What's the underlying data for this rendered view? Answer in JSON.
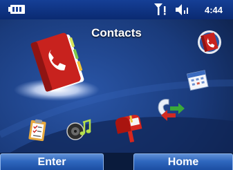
{
  "status": {
    "time": "4:44",
    "battery_icon": "battery-icon",
    "signal_icon": "signal-icon",
    "volume_icon": "volume-icon"
  },
  "home": {
    "selected_title": "Contacts",
    "apps": [
      {
        "id": "contacts",
        "icon": "contacts-book-icon",
        "selected": true
      },
      {
        "id": "contacts-small",
        "icon": "contacts-small-icon"
      },
      {
        "id": "calendar",
        "icon": "calendar-icon"
      },
      {
        "id": "call-history",
        "icon": "call-history-icon"
      },
      {
        "id": "tasks",
        "icon": "clipboard-icon"
      },
      {
        "id": "music",
        "icon": "music-icon"
      },
      {
        "id": "messaging",
        "icon": "mailbox-icon"
      }
    ]
  },
  "softkeys": {
    "left": "Enter",
    "right": "Home"
  },
  "colors": {
    "accent": "#2f67be",
    "status_bar": "#0a2a72",
    "background": "#14306a"
  }
}
